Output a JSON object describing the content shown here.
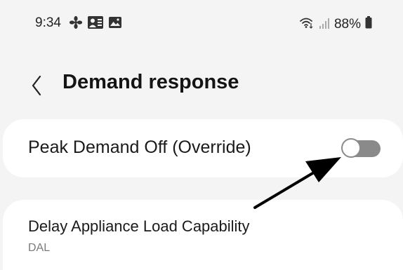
{
  "status_bar": {
    "time": "9:34",
    "battery_percent": "88%",
    "icons_left": [
      "pinwheel-icon",
      "contact-card-icon",
      "gallery-icon"
    ],
    "icons_right": [
      "wifi-icon",
      "signal-icon",
      "battery-icon"
    ]
  },
  "header": {
    "title": "Demand response",
    "back_icon": "chevron-left-icon"
  },
  "settings": {
    "peak_demand": {
      "label": "Peak Demand Off (Override)",
      "enabled": false
    },
    "delay_appliance": {
      "label": "Delay Appliance Load Capability",
      "sublabel": "DAL"
    }
  },
  "annotation": {
    "type": "arrow",
    "color": "#000000"
  }
}
